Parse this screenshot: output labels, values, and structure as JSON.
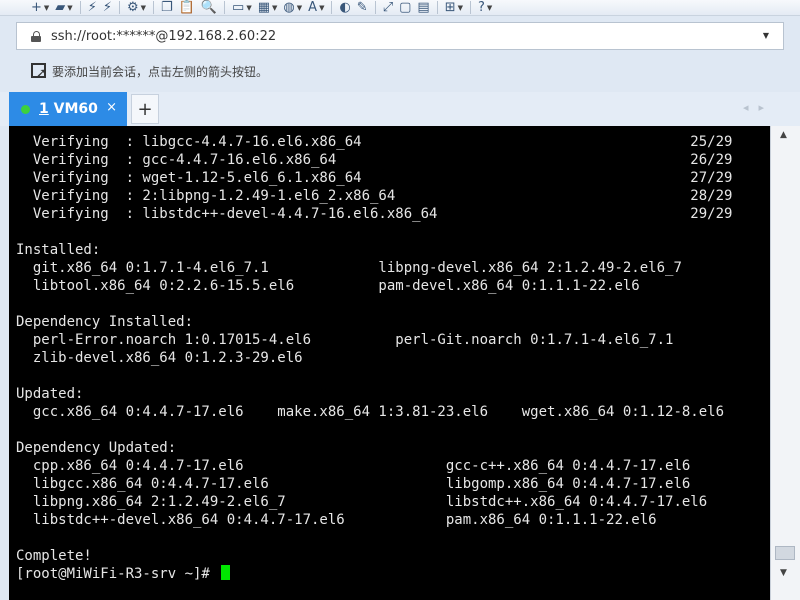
{
  "toolbar": {
    "buttons": [
      {
        "icon": "new-session-icon",
        "glyph": "+",
        "dropdown": true
      },
      {
        "icon": "open-folder-icon",
        "glyph": "▰",
        "dropdown": true
      },
      {
        "icon": "connect-icon",
        "glyph": "⚡",
        "dropdown": false
      },
      {
        "icon": "disconnect-icon",
        "glyph": "⚡",
        "dropdown": false
      },
      {
        "icon": "settings-icon",
        "glyph": "⚙",
        "dropdown": true
      },
      {
        "icon": "copy-icon",
        "glyph": "❐",
        "dropdown": false
      },
      {
        "icon": "paste-icon",
        "glyph": "📋",
        "dropdown": false
      },
      {
        "icon": "find-icon",
        "glyph": "🔍",
        "dropdown": false
      },
      {
        "icon": "monitor-icon",
        "glyph": "▭",
        "dropdown": true
      },
      {
        "icon": "layout-icon",
        "glyph": "▦",
        "dropdown": true
      },
      {
        "icon": "globe-icon",
        "glyph": "◍",
        "dropdown": true
      },
      {
        "icon": "font-icon",
        "glyph": "A",
        "dropdown": true
      },
      {
        "icon": "transfer-icon",
        "glyph": "◐",
        "dropdown": false
      },
      {
        "icon": "script-icon",
        "glyph": "✎",
        "dropdown": false
      },
      {
        "icon": "fullscreen-icon",
        "glyph": "⤢",
        "dropdown": false
      },
      {
        "icon": "lock-icon",
        "glyph": "▢",
        "dropdown": false
      },
      {
        "icon": "keyboard-icon",
        "glyph": "▤",
        "dropdown": false
      },
      {
        "icon": "add-icon",
        "glyph": "⊞",
        "dropdown": true
      },
      {
        "icon": "help-icon",
        "glyph": "?",
        "dropdown": true
      }
    ]
  },
  "address": {
    "value": "ssh://root:******@192.168.2.60:22"
  },
  "hint": {
    "text": "要添加当前会话，点击左侧的箭头按钮。"
  },
  "tabs": [
    {
      "number": "1",
      "name": " VM60",
      "close": "×"
    }
  ],
  "new_tab_label": "+",
  "colors": {
    "tab_active": "#2d8be6",
    "status_connected": "#3dd13d",
    "terminal_bg": "#000000",
    "terminal_fg": "#e6e6e6",
    "cursor": "#00e600"
  },
  "terminal": {
    "lines": [
      "  Verifying  : libgcc-4.4.7-16.el6.x86_64                                       25/29",
      "  Verifying  : gcc-4.4.7-16.el6.x86_64                                          26/29",
      "  Verifying  : wget-1.12-5.el6_6.1.x86_64                                       27/29",
      "  Verifying  : 2:libpng-1.2.49-1.el6_2.x86_64                                   28/29",
      "  Verifying  : libstdc++-devel-4.4.7-16.el6.x86_64                              29/29",
      "",
      "Installed:",
      "  git.x86_64 0:1.7.1-4.el6_7.1             libpng-devel.x86_64 2:1.2.49-2.el6_7",
      "  libtool.x86_64 0:2.2.6-15.5.el6          pam-devel.x86_64 0:1.1.1-22.el6",
      "",
      "Dependency Installed:",
      "  perl-Error.noarch 1:0.17015-4.el6          perl-Git.noarch 0:1.7.1-4.el6_7.1",
      "  zlib-devel.x86_64 0:1.2.3-29.el6",
      "",
      "Updated:",
      "  gcc.x86_64 0:4.4.7-17.el6    make.x86_64 1:3.81-23.el6    wget.x86_64 0:1.12-8.el6",
      "",
      "Dependency Updated:",
      "  cpp.x86_64 0:4.4.7-17.el6                        gcc-c++.x86_64 0:4.4.7-17.el6",
      "  libgcc.x86_64 0:4.4.7-17.el6                     libgomp.x86_64 0:4.4.7-17.el6",
      "  libpng.x86_64 2:1.2.49-2.el6_7                   libstdc++.x86_64 0:4.4.7-17.el6",
      "  libstdc++-devel.x86_64 0:4.4.7-17.el6            pam.x86_64 0:1.1.1-22.el6",
      "",
      "Complete!"
    ],
    "prompt": "[root@MiWiFi-R3-srv ~]# "
  }
}
